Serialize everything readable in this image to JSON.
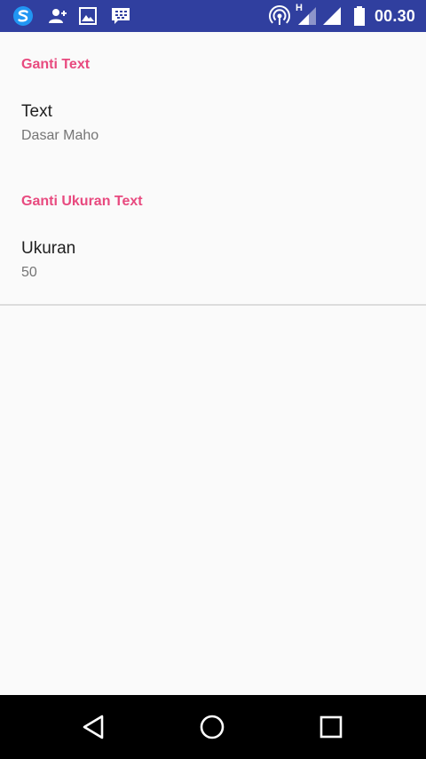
{
  "status_bar": {
    "time": "00.30",
    "network_type": "H",
    "icons": [
      "s-app-icon",
      "add-contact-icon",
      "image-icon",
      "bbm-icon",
      "hotspot-icon",
      "signal-icon",
      "signal-icon",
      "battery-icon"
    ],
    "background_color": "#303f9f"
  },
  "preferences": {
    "category_text": "Ganti Text",
    "text_item": {
      "title": "Text",
      "summary": "Dasar Maho"
    },
    "category_size": "Ganti Ukuran Text",
    "size_item": {
      "title": "Ukuran",
      "summary": "50"
    },
    "accent_color": "#e84a7f"
  },
  "nav_bar": {
    "icons": [
      "back-icon",
      "home-icon",
      "recents-icon"
    ]
  }
}
